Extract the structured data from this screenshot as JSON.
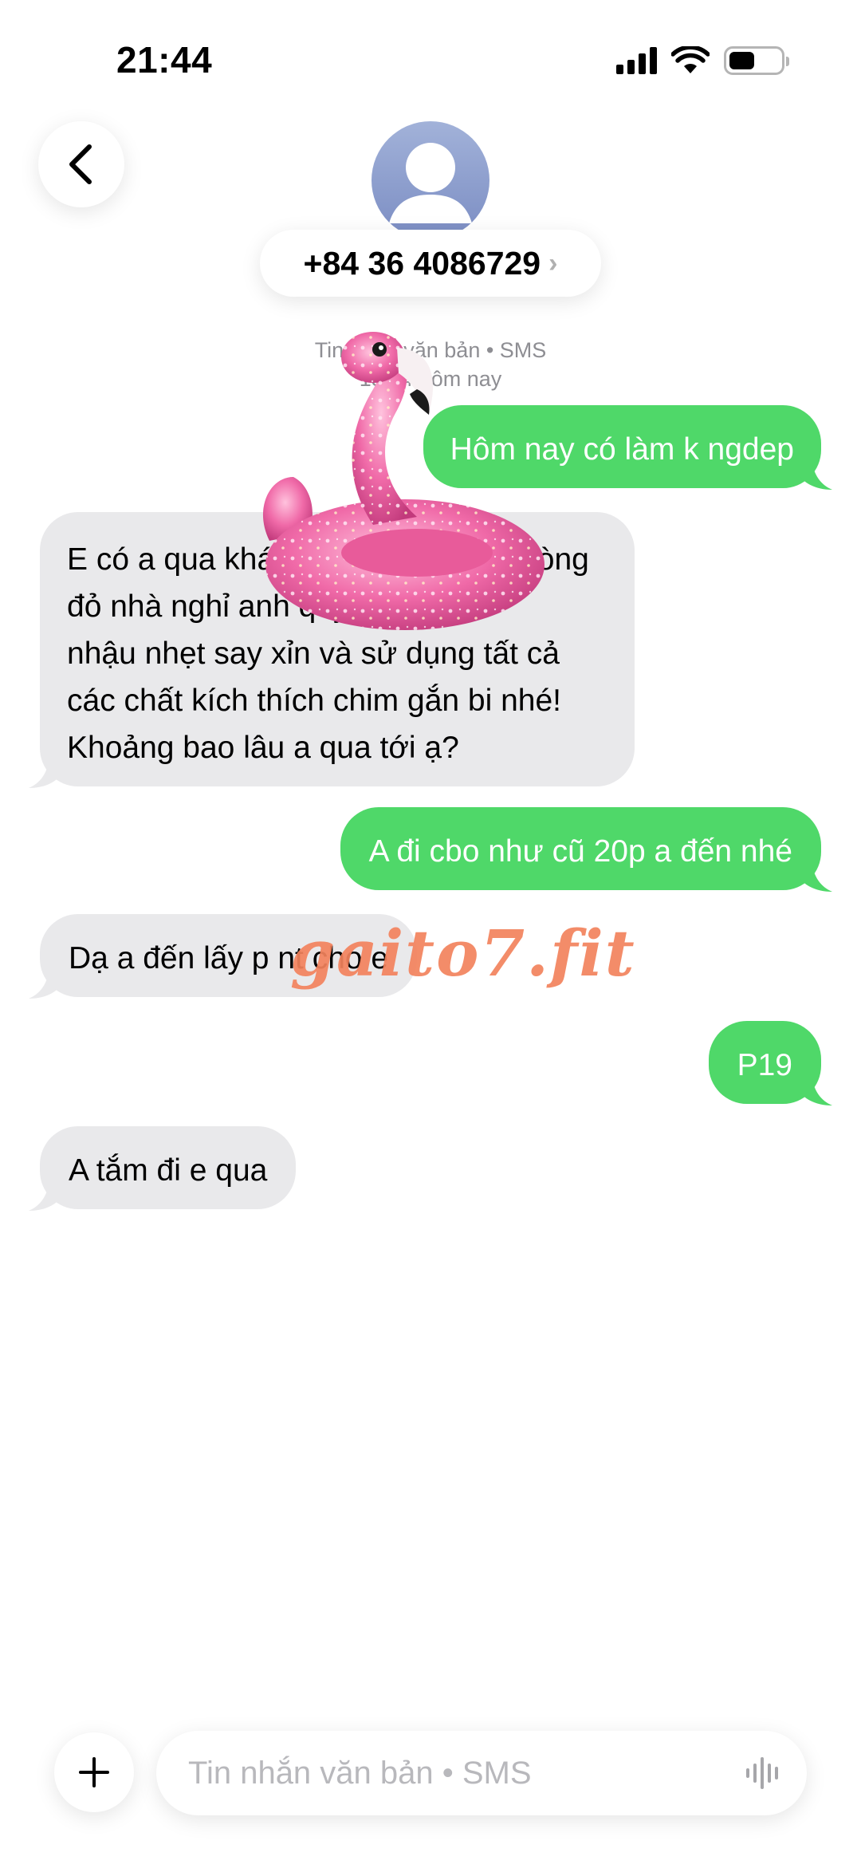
{
  "status_bar": {
    "time": "21:44"
  },
  "header": {
    "contact": "+84 36 4086729",
    "chevron": "›"
  },
  "meta": {
    "line1": "Tin nhắn văn bản • SMS",
    "line2": "13:34 hôm nay"
  },
  "messages": [
    {
      "direction": "outgoing",
      "lines": [
        "Hôm nay có làm k ngdep"
      ]
    },
    {
      "direction": "incoming",
      "lines": [
        "E có a qua khách sạn nhà nghỉ phòng",
        "đỏ nhà nghỉ anh quý... bk làm",
        "nhậu nhẹt say xỉn và sử dụng tất cả",
        "các chất kích thích chim gắn bi nhé!",
        "Khoảng bao lâu a qua tới ạ?"
      ]
    },
    {
      "direction": "outgoing",
      "lines": [
        "A đi cbo như cũ 20p a đến nhé"
      ]
    },
    {
      "direction": "incoming",
      "lines": [
        "Dạ a đến lấy p nt cho e"
      ]
    },
    {
      "direction": "outgoing",
      "lines": [
        "P19"
      ]
    },
    {
      "direction": "incoming",
      "lines": [
        "A tắm đi e qua"
      ]
    }
  ],
  "overlay": {
    "watermark": "gaito7.fit",
    "sticker": "pink-flamingo-float"
  },
  "composer": {
    "placeholder": "Tin nhắn văn bản • SMS"
  },
  "colors": {
    "outgoing": "#4fd869",
    "incoming": "#e9e9eb",
    "meta": "#8e8e93",
    "watermark": "#f3835d",
    "flamingo": "#f06aa8"
  },
  "icons": {
    "back": "chevron-left-icon",
    "avatar": "person-icon",
    "plus": "plus-icon",
    "mic": "waveform-icon"
  }
}
